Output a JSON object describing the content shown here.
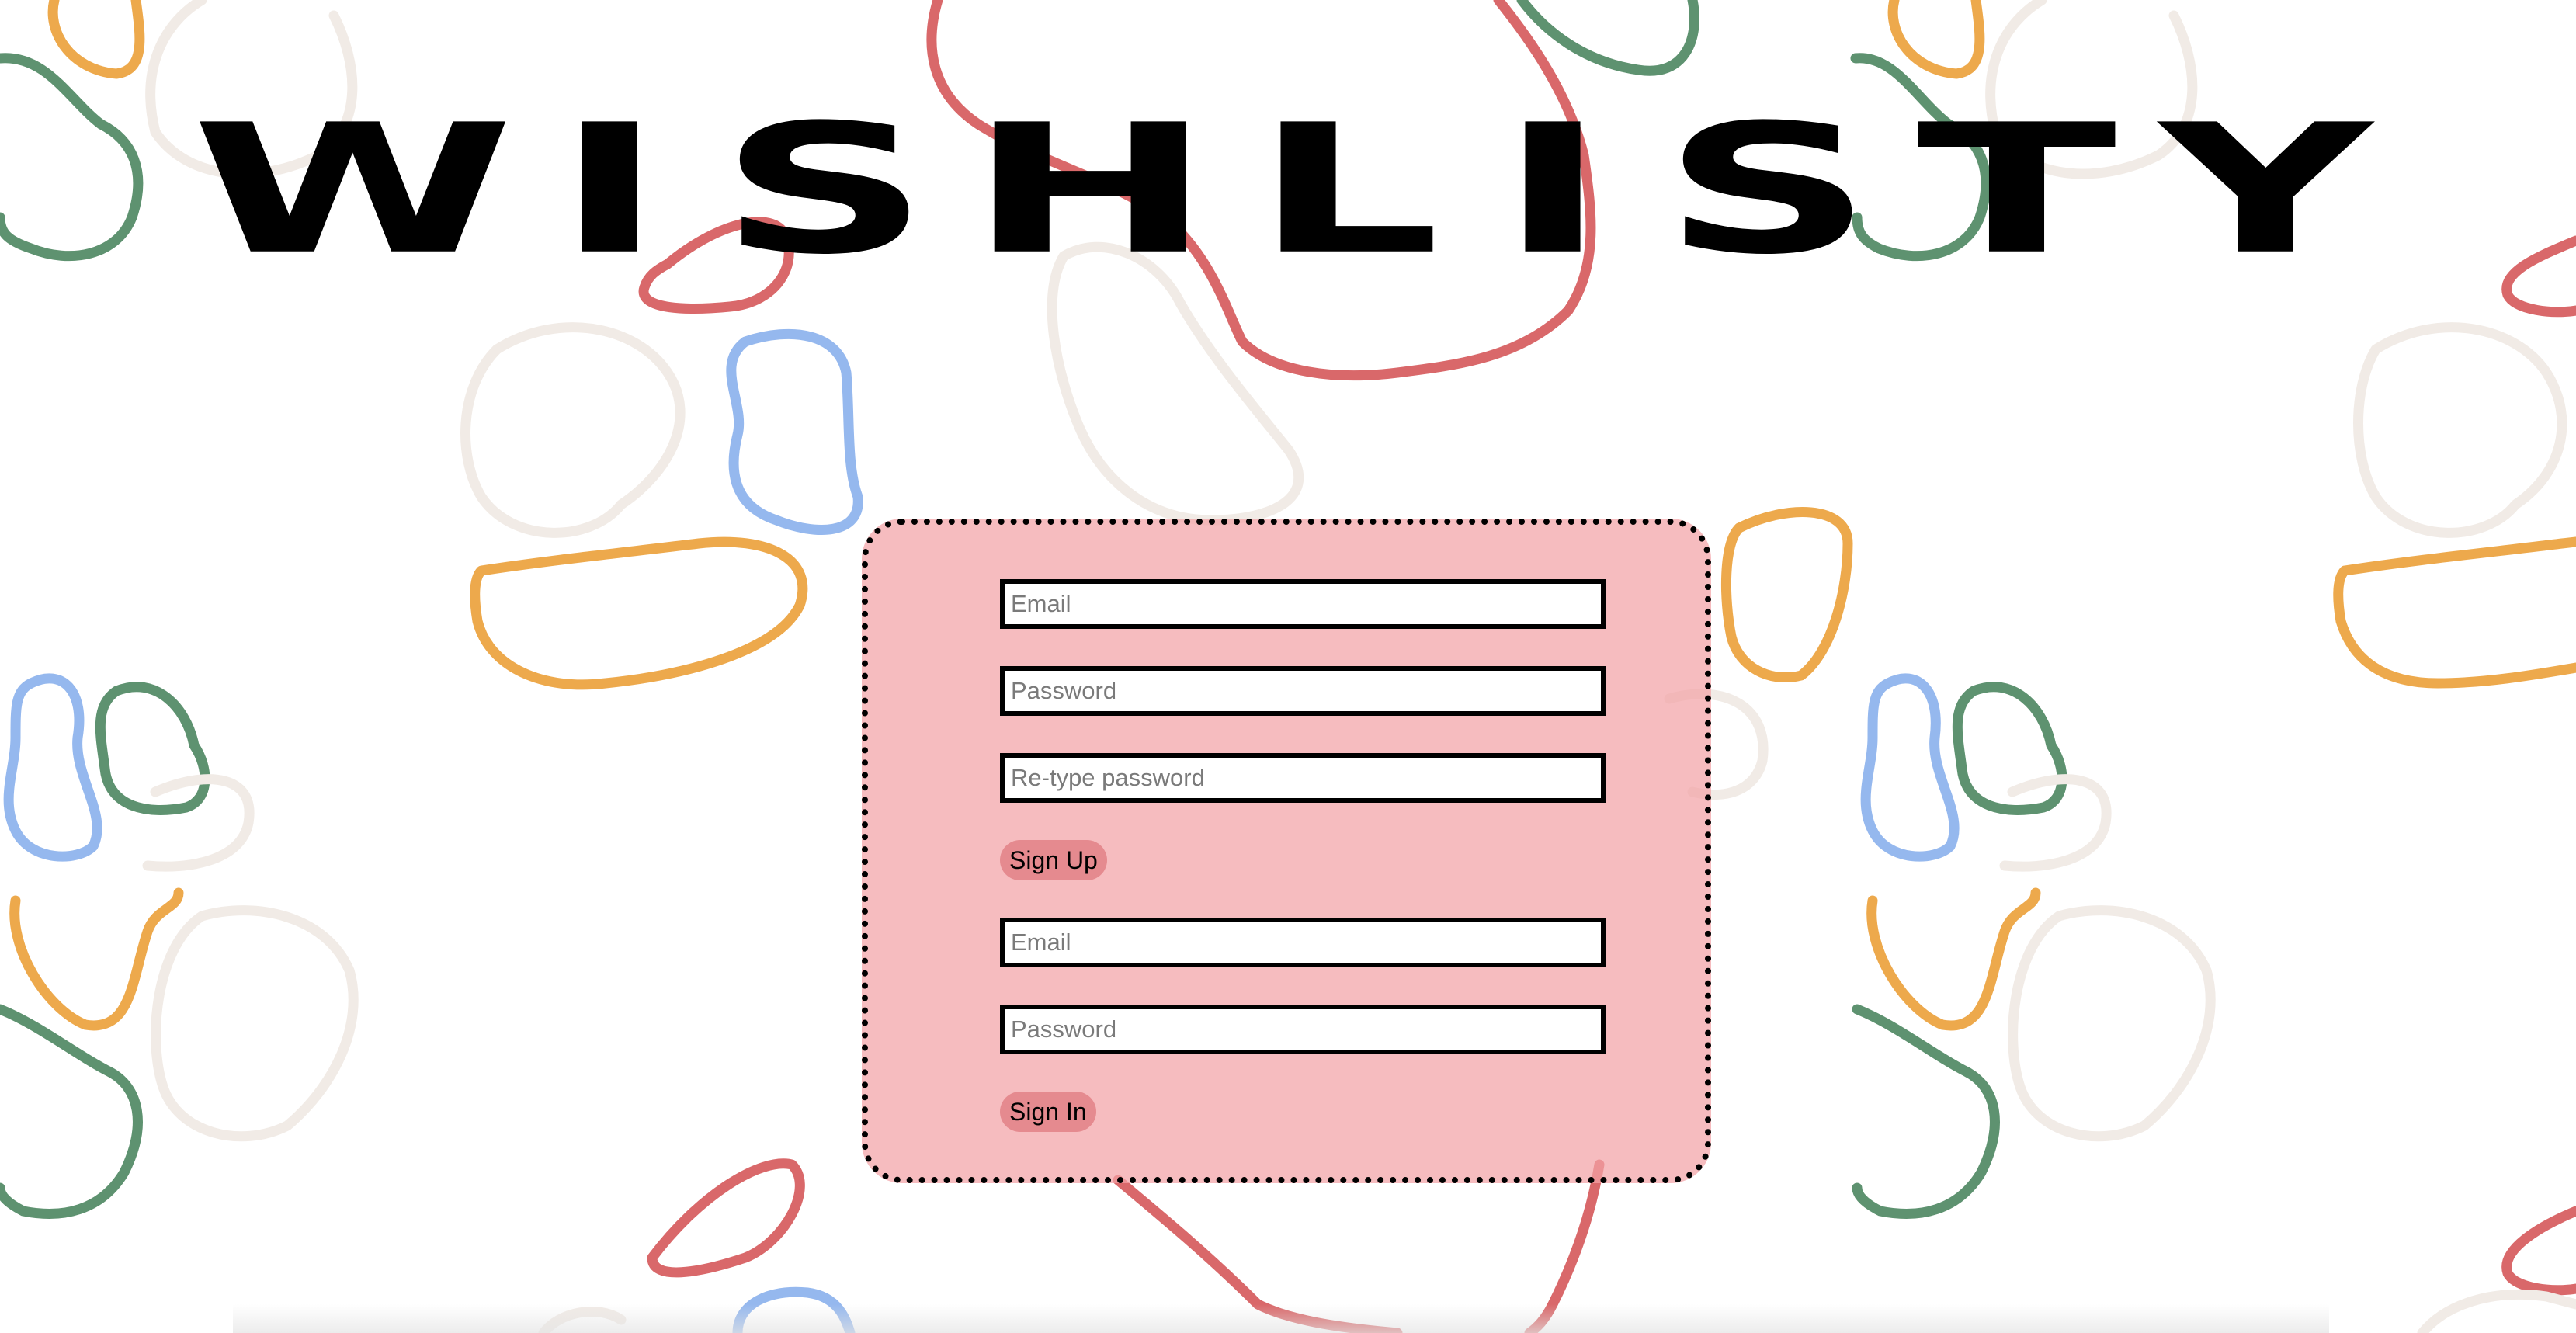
{
  "app": {
    "title": "WISHLISTY",
    "title_letters": [
      "W",
      "I",
      "S",
      "H",
      "L",
      "I",
      "S",
      "T",
      "Y"
    ]
  },
  "signup": {
    "email_placeholder": "Email",
    "password_placeholder": "Password",
    "retype_placeholder": "Re-type password",
    "button_label": "Sign Up"
  },
  "signin": {
    "email_placeholder": "Email",
    "password_placeholder": "Password",
    "button_label": "Sign In"
  },
  "colors": {
    "card_background": "#f2a2a6",
    "button_background": "#e58a8f",
    "doodle_red": "#d9686a",
    "doodle_green": "#5e9270",
    "doodle_orange": "#eda94c",
    "doodle_blue": "#95b8ee",
    "doodle_beige": "#f1ebe6"
  }
}
